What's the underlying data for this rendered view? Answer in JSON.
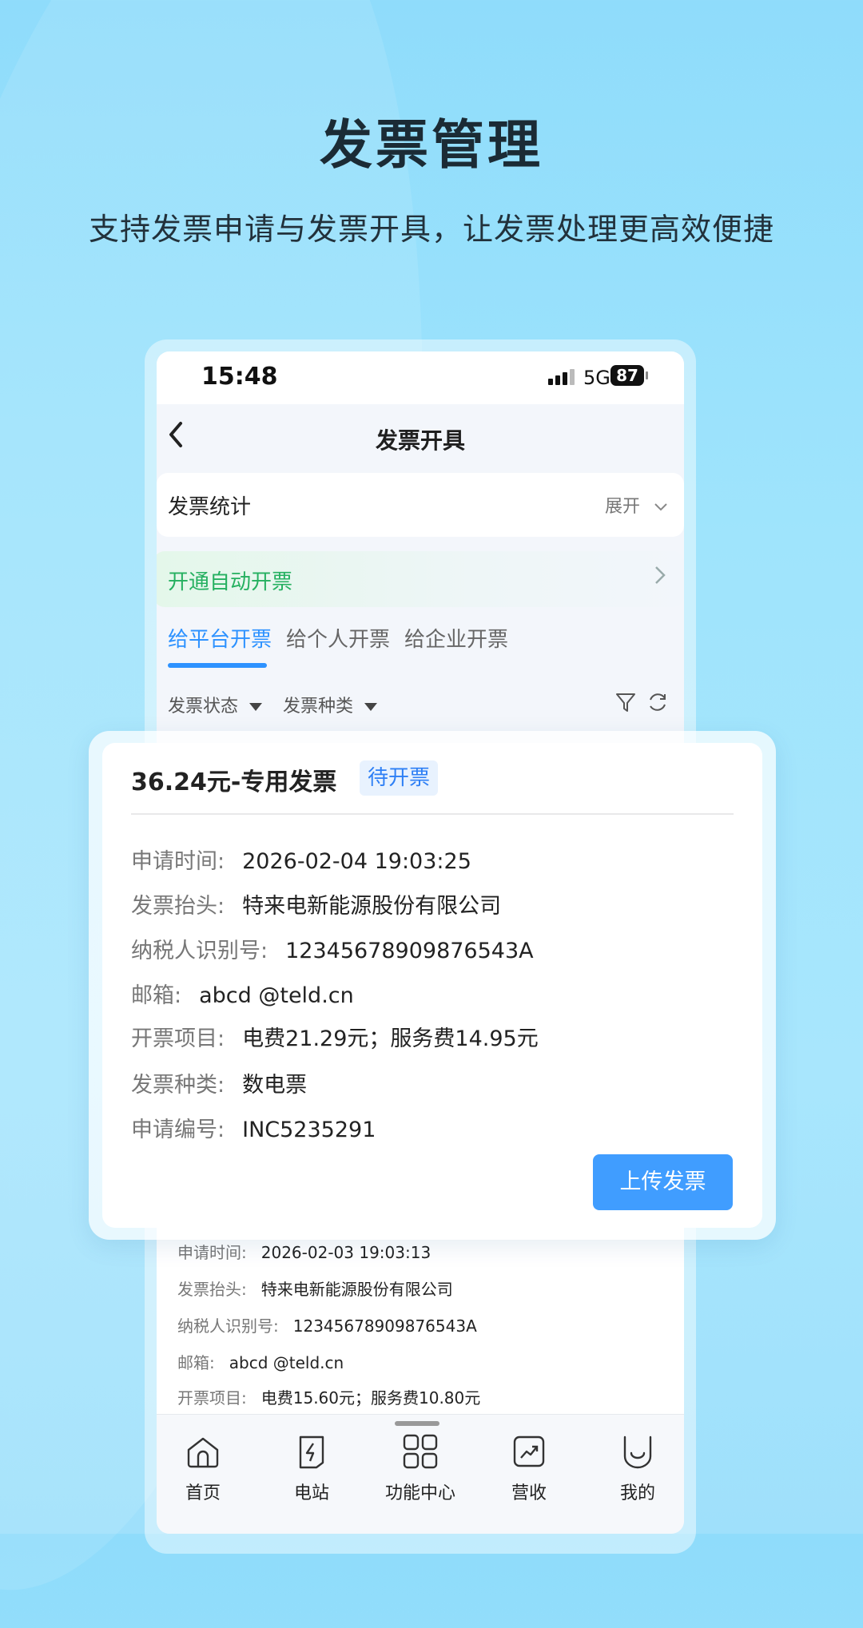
{
  "headline": {
    "title": "发票管理",
    "subtitle": "支持发票申请与发票开具，让发票处理更高效便捷"
  },
  "status_bar": {
    "time": "15:48",
    "network": "5G",
    "battery": "87"
  },
  "nav": {
    "back_icon": "chevron-left-icon",
    "title": "发票开具"
  },
  "stats": {
    "label": "发票统计",
    "toggle": "展开"
  },
  "auto_invoice": {
    "label": "开通自动开票"
  },
  "tabs": [
    {
      "label": "给平台开票",
      "active": true
    },
    {
      "label": "给个人开票",
      "active": false
    },
    {
      "label": "给企业开票",
      "active": false
    }
  ],
  "filters": {
    "status": "发票状态",
    "type": "发票种类"
  },
  "card": {
    "title": "36.24元-专用发票",
    "badge": "待开票",
    "rows": [
      {
        "key": "申请时间:",
        "value": "2026-02-04 19:03:25"
      },
      {
        "key": "发票抬头:",
        "value": "特来电新能源股份有限公司"
      },
      {
        "key": "纳税人识别号:",
        "value": "12345678909876543A"
      },
      {
        "key": "邮箱:",
        "value": "abcd @teld.cn"
      },
      {
        "key": "开票项目:",
        "value": "电费21.29元；服务费14.95元"
      },
      {
        "key": "发票种类:",
        "value": "数电票"
      },
      {
        "key": "申请编号:",
        "value": "INC5235291"
      }
    ],
    "button": "上传发票"
  },
  "list_item_2": {
    "rows": [
      {
        "key": "申请时间:",
        "value": "2026-02-03 19:03:13"
      },
      {
        "key": "发票抬头:",
        "value": "特来电新能源股份有限公司"
      },
      {
        "key": "纳税人识别号:",
        "value": "12345678909876543A"
      },
      {
        "key": "邮箱:",
        "value": "abcd @teld.cn"
      },
      {
        "key": "开票项目:",
        "value": "电费15.60元；服务费10.80元"
      }
    ]
  },
  "tabbar": [
    {
      "label": "首页",
      "icon": "home-icon"
    },
    {
      "label": "电站",
      "icon": "station-icon"
    },
    {
      "label": "功能中心",
      "icon": "grid-icon"
    },
    {
      "label": "营收",
      "icon": "revenue-icon"
    },
    {
      "label": "我的",
      "icon": "profile-icon"
    }
  ],
  "colors": {
    "accent": "#2d92ff",
    "button": "#409dff",
    "green": "#25b060",
    "background": "#9fe4fc"
  }
}
